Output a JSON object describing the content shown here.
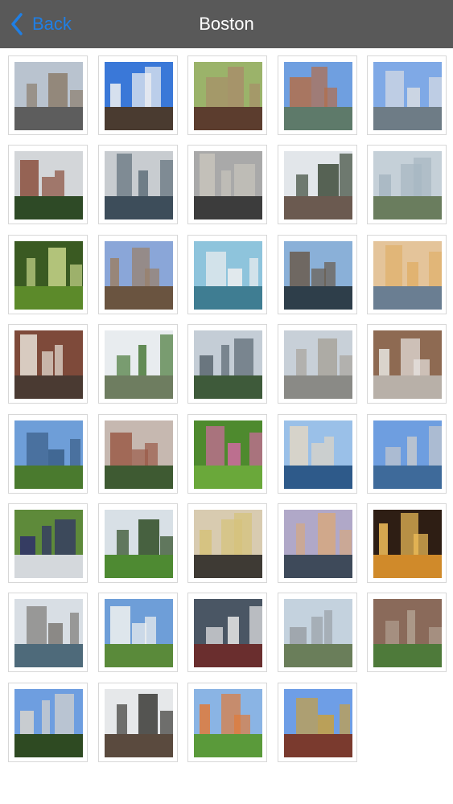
{
  "nav": {
    "back_label": "Back",
    "title": "Boston",
    "back_color": "#1f7fe5",
    "bar_color": "#595959"
  },
  "photos": [
    {
      "name": "photo-highway-skyline",
      "sky": "#b9c3cf",
      "ground": "#5d5d5d",
      "accent": "#8c7e6c"
    },
    {
      "name": "photo-custom-house-tower",
      "sky": "#3a78d8",
      "ground": "#4a3b30",
      "accent": "#f2f2f2"
    },
    {
      "name": "photo-brick-building-corner",
      "sky": "#9bb36a",
      "ground": "#5c3d2e",
      "accent": "#a88e6a"
    },
    {
      "name": "photo-waterfront-lofts",
      "sky": "#6f9fe0",
      "ground": "#5e7a6a",
      "accent": "#b36e4a"
    },
    {
      "name": "photo-seaport-towers",
      "sky": "#7fa9e6",
      "ground": "#6e7c86",
      "accent": "#d8dde2"
    },
    {
      "name": "photo-gothic-church",
      "sky": "#d3d6d9",
      "ground": "#2e4a26",
      "accent": "#8a4f3c"
    },
    {
      "name": "photo-charles-river-skyline",
      "sky": "#c8ccd0",
      "ground": "#3d4d5a",
      "accent": "#5f6f7a"
    },
    {
      "name": "photo-rowes-wharf-arch",
      "sky": "#a9a9a9",
      "ground": "#3c3c3c",
      "accent": "#c8c4bc"
    },
    {
      "name": "photo-battery-wharf-sign",
      "sky": "#e2e6ea",
      "ground": "#6b5a50",
      "accent": "#3d4a3a"
    },
    {
      "name": "photo-harbor-aerial",
      "sky": "#c5d0d8",
      "ground": "#6a7d5e",
      "accent": "#a6b6c2"
    },
    {
      "name": "photo-park-path-evening",
      "sky": "#3a5a22",
      "ground": "#5c8a2a",
      "accent": "#c8d68a"
    },
    {
      "name": "photo-bunker-hill-tower",
      "sky": "#8aa6d8",
      "ground": "#6a5440",
      "accent": "#9a8068"
    },
    {
      "name": "photo-marina-boats",
      "sky": "#8ec4dc",
      "ground": "#3f7d92",
      "accent": "#f0f0f0"
    },
    {
      "name": "photo-pier-bridge",
      "sky": "#8ab0d8",
      "ground": "#2e3e4a",
      "accent": "#6a5c4e"
    },
    {
      "name": "photo-sunset-esplanade",
      "sky": "#e4c49a",
      "ground": "#6a7e92",
      "accent": "#e0b06a"
    },
    {
      "name": "photo-beacon-hill-rowhouses",
      "sky": "#7e4a3a",
      "ground": "#4a3a32",
      "accent": "#e8e2d8"
    },
    {
      "name": "photo-lagoon-bridge",
      "sky": "#e8ecef",
      "ground": "#6e7d60",
      "accent": "#4a7a3a"
    },
    {
      "name": "photo-pond-skyline",
      "sky": "#c4cdd6",
      "ground": "#3e5a3a",
      "accent": "#5a6670"
    },
    {
      "name": "photo-custom-house-closeup",
      "sky": "#c8d0d8",
      "ground": "#8a8a86",
      "accent": "#a8a49c"
    },
    {
      "name": "photo-church-tower-city",
      "sky": "#8e6a52",
      "ground": "#b8b0a8",
      "accent": "#e8e6e2"
    },
    {
      "name": "photo-tree-lined-avenue",
      "sky": "#6e9ed8",
      "ground": "#4a7a2e",
      "accent": "#3a5e88"
    },
    {
      "name": "photo-brick-apartment-corner",
      "sky": "#c6b8b0",
      "ground": "#3e5a32",
      "accent": "#9a5a48"
    },
    {
      "name": "photo-flower-urn",
      "sky": "#4e8a2e",
      "ground": "#6aa83a",
      "accent": "#d06aa0"
    },
    {
      "name": "photo-river-skyline-day",
      "sky": "#9ac0e8",
      "ground": "#2e5a8a",
      "accent": "#e0d6c4"
    },
    {
      "name": "photo-waterfront-highrises",
      "sky": "#6e9ee0",
      "ground": "#3e6a9a",
      "accent": "#c4c8cc"
    },
    {
      "name": "photo-graffiti-wall",
      "sky": "#5e8a3a",
      "ground": "#d4d8dc",
      "accent": "#2e2e6a"
    },
    {
      "name": "photo-common-lawn-trees",
      "sky": "#d8e0e6",
      "ground": "#4e8a32",
      "accent": "#2e4a22"
    },
    {
      "name": "photo-yellow-house-fence",
      "sky": "#d8cbb0",
      "ground": "#3e3a34",
      "accent": "#d6c27a"
    },
    {
      "name": "photo-dusk-waterfront",
      "sky": "#b0a8c8",
      "ground": "#3e4a5a",
      "accent": "#d6a880"
    },
    {
      "name": "photo-night-plaza-lights",
      "sky": "#2e1e14",
      "ground": "#d08a2a",
      "accent": "#f2c05a"
    },
    {
      "name": "photo-skyline-from-harbor",
      "sky": "#d8dee4",
      "ground": "#4e6a7a",
      "accent": "#7e7a76"
    },
    {
      "name": "photo-blossom-tree",
      "sky": "#6e9ed8",
      "ground": "#5a8a3a",
      "accent": "#f2f2f0"
    },
    {
      "name": "photo-old-state-house",
      "sky": "#4a5664",
      "ground": "#6a2e2e",
      "accent": "#e8e8e8"
    },
    {
      "name": "photo-aerial-city-park",
      "sky": "#c4d2de",
      "ground": "#6a7e5a",
      "accent": "#9aa0a6"
    },
    {
      "name": "photo-rooftops-aerial",
      "sky": "#8a6a5a",
      "ground": "#4e7a3a",
      "accent": "#b0a090"
    },
    {
      "name": "photo-custom-house-street",
      "sky": "#6e9ee0",
      "ground": "#2e4a22",
      "accent": "#d8d4cc"
    },
    {
      "name": "photo-paul-revere-statue",
      "sky": "#e6e8ea",
      "ground": "#5a4a3e",
      "accent": "#3a3a36"
    },
    {
      "name": "photo-lamp-park-path",
      "sky": "#8ab4e4",
      "ground": "#5a9a3a",
      "accent": "#e07a3a"
    },
    {
      "name": "photo-grasshopper-weathervane",
      "sky": "#6e9ee6",
      "ground": "#7a3a2e",
      "accent": "#c8a040"
    }
  ]
}
